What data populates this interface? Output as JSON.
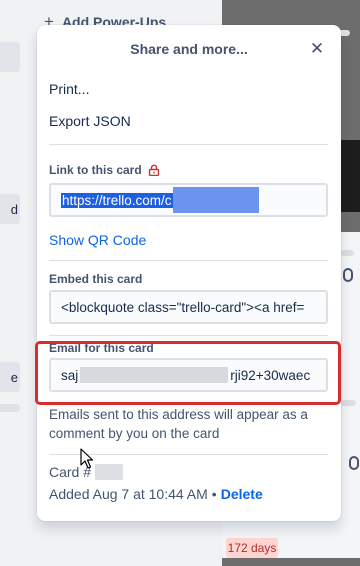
{
  "background": {
    "add_powerups_label": "Add Power-Ups",
    "chip_d": "d",
    "chip_e": "e",
    "days_badge": "172 days"
  },
  "popover": {
    "title": "Share and more...",
    "menu": {
      "print": "Print...",
      "export_json": "Export JSON"
    },
    "link_section": {
      "label": "Link to this card",
      "url_visible": "https://trello.com/c"
    },
    "show_qr": "Show QR Code",
    "embed_section": {
      "label": "Embed this card",
      "value": "<blockquote class=\"trello-card\"><a href="
    },
    "email_section": {
      "label": "Email for this card",
      "value_prefix": "saj",
      "value_suffix": "rji92+30waec",
      "hint": "Emails sent to this address will appear as a comment by you on the card"
    },
    "card_number_label": "Card #",
    "added_text": "Added Aug 7 at 10:44 AM",
    "separator": "•",
    "delete_label": "Delete"
  },
  "colors": {
    "link": "#0c66e4",
    "highlight_border": "#d92d2d",
    "lock_icon": "#c9372c"
  }
}
